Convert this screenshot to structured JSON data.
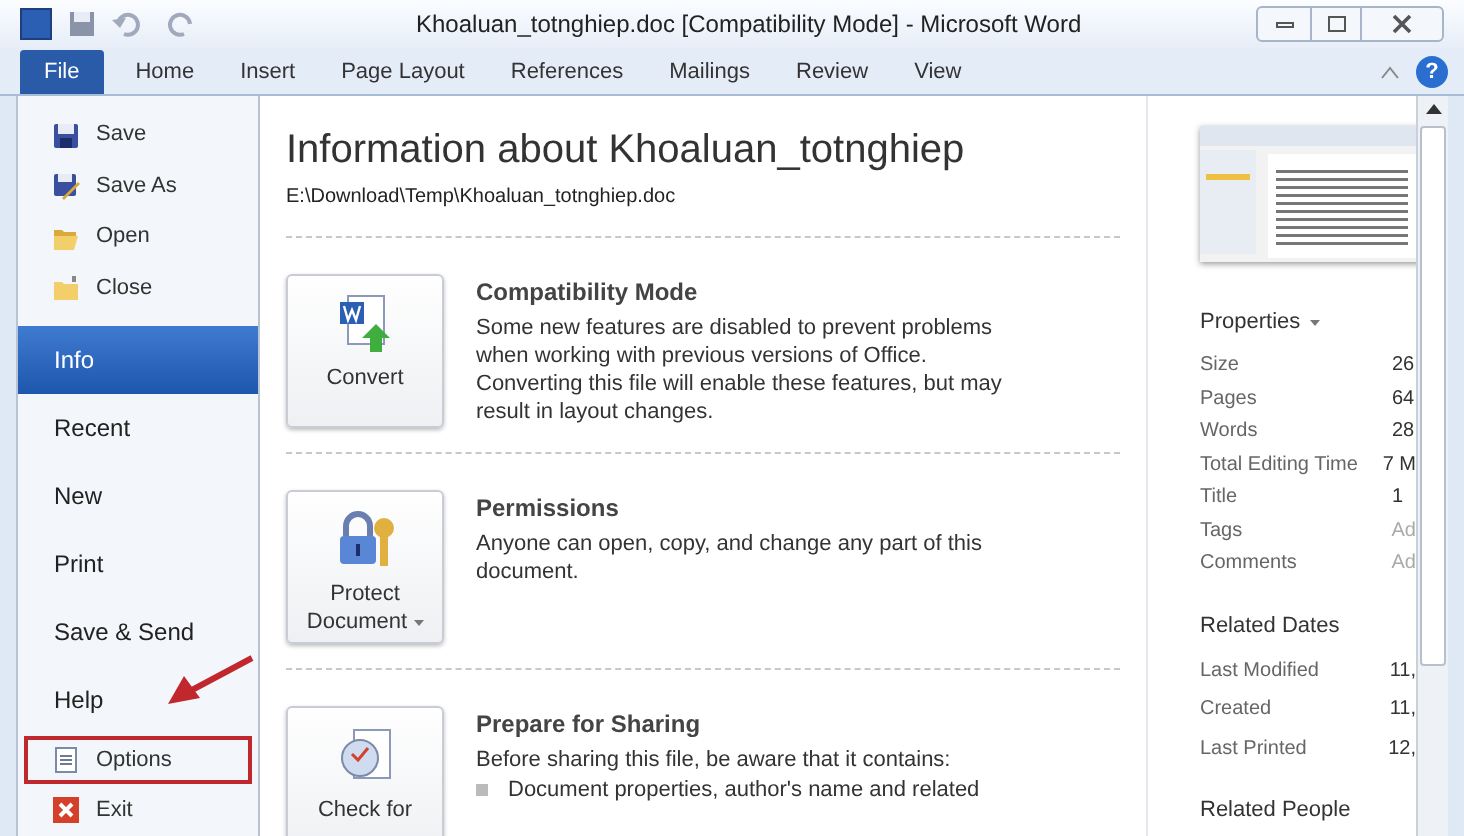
{
  "window": {
    "title": "Khoaluan_totnghiep.doc [Compatibility Mode]  -  Microsoft Word",
    "help": "?"
  },
  "ribbon_tabs": [
    {
      "label": "File",
      "selected": true
    },
    {
      "label": "Home",
      "selected": false
    },
    {
      "label": "Insert",
      "selected": false
    },
    {
      "label": "Page Layout",
      "selected": false
    },
    {
      "label": "References",
      "selected": false
    },
    {
      "label": "Mailings",
      "selected": false
    },
    {
      "label": "Review",
      "selected": false
    },
    {
      "label": "View",
      "selected": false
    }
  ],
  "nav": [
    {
      "kind": "command",
      "label": "Save",
      "selected": false,
      "highlighted": false
    },
    {
      "kind": "command",
      "label": "Save As",
      "selected": false,
      "highlighted": false
    },
    {
      "kind": "command",
      "label": "Open",
      "selected": false,
      "highlighted": false
    },
    {
      "kind": "command",
      "label": "Close",
      "selected": false,
      "highlighted": false
    },
    {
      "kind": "tab",
      "label": "Info",
      "selected": true,
      "highlighted": false
    },
    {
      "kind": "tab",
      "label": "Recent",
      "selected": false,
      "highlighted": false
    },
    {
      "kind": "tab",
      "label": "New",
      "selected": false,
      "highlighted": false
    },
    {
      "kind": "tab",
      "label": "Print",
      "selected": false,
      "highlighted": false
    },
    {
      "kind": "tab",
      "label": "Save & Send",
      "selected": false,
      "highlighted": false
    },
    {
      "kind": "tab",
      "label": "Help",
      "selected": false,
      "highlighted": false
    },
    {
      "kind": "command",
      "label": "Options",
      "selected": false,
      "highlighted": true
    },
    {
      "kind": "command",
      "label": "Exit",
      "selected": false,
      "highlighted": false
    }
  ],
  "info": {
    "heading": "Information about Khoaluan_totnghiep",
    "path": "E:\\Download\\Temp\\Khoaluan_totnghiep.doc",
    "sections": [
      {
        "button": "Convert",
        "dropdown": false,
        "title": "Compatibility Mode",
        "text": "Some new features are disabled to prevent problems when working with previous versions of Office. Converting this file will enable these features, but may result in layout changes."
      },
      {
        "button": "Protect Document",
        "dropdown": true,
        "title": "Permissions",
        "text": "Anyone can open, copy, and change any part of this document."
      },
      {
        "button": "Check for",
        "dropdown": false,
        "title": "Prepare for Sharing",
        "text": "Before sharing this file, be aware that it contains:",
        "bullets": [
          "Document properties, author's name and related"
        ]
      }
    ]
  },
  "properties": {
    "heading": "Properties",
    "rows": [
      {
        "label": "Size",
        "value": "26",
        "muted": false
      },
      {
        "label": "Pages",
        "value": "64",
        "muted": false
      },
      {
        "label": "Words",
        "value": "28",
        "muted": false
      },
      {
        "label": "Total Editing Time",
        "value": "7 M",
        "muted": false
      },
      {
        "label": "Title",
        "value": "1",
        "muted": false
      },
      {
        "label": "Tags",
        "value": "Ad",
        "muted": true
      },
      {
        "label": "Comments",
        "value": "Ad",
        "muted": true
      }
    ],
    "dates_heading": "Related Dates",
    "dates": [
      {
        "label": "Last Modified",
        "value": "11,"
      },
      {
        "label": "Created",
        "value": "11,"
      },
      {
        "label": "Last Printed",
        "value": "12,"
      }
    ],
    "people_heading": "Related People"
  }
}
